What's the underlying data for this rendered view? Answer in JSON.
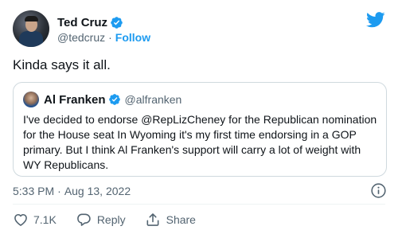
{
  "author": {
    "display_name": "Ted Cruz",
    "handle": "@tedcruz",
    "separator": "·",
    "follow_label": "Follow"
  },
  "tweet": {
    "text": "Kinda says it all."
  },
  "quoted": {
    "display_name": "Al Franken",
    "handle": "@alfranken",
    "text": "I've decided to endorse @RepLizCheney for the Republican nomination for the House seat In Wyoming it's my first time endorsing in a GOP primary. But I think Al Franken's support will carry a lot of weight with WY Republicans."
  },
  "meta": {
    "time": "5:33 PM",
    "separator": "·",
    "date": "Aug 13, 2022"
  },
  "actions": {
    "like_count": "7.1K",
    "reply_label": "Reply",
    "share_label": "Share"
  },
  "colors": {
    "accent": "#1d9bf0",
    "text": "#0f1419",
    "secondary": "#536471",
    "border": "#cfd9de",
    "like_icon": "#536471"
  },
  "icons": {
    "verified": "verified-badge-icon",
    "logo": "twitter-bird-icon",
    "info": "info-icon",
    "like": "heart-icon",
    "reply": "speech-bubble-icon",
    "share": "share-upload-icon"
  }
}
